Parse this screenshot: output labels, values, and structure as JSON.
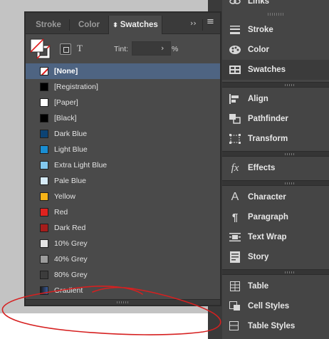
{
  "swatches_panel": {
    "tabs": [
      {
        "label": "Stroke",
        "active": false
      },
      {
        "label": "Color",
        "active": false
      },
      {
        "label": "Swatches",
        "active": true
      }
    ],
    "active_tab_prefix": "⬍",
    "collapse_glyph": "››",
    "menu_glyph": "≡",
    "tint_label": "Tint:",
    "tint_value": "",
    "tint_unit": "%",
    "text_button": "T",
    "swatches": [
      {
        "name": "[None]",
        "color": "none",
        "selected": true
      },
      {
        "name": "[Registration]",
        "color": "#000000",
        "selected": false
      },
      {
        "name": "[Paper]",
        "color": "#ffffff",
        "selected": false
      },
      {
        "name": "[Black]",
        "color": "#000000",
        "selected": false
      },
      {
        "name": "Dark Blue",
        "color": "#0c4374",
        "selected": false
      },
      {
        "name": "Light Blue",
        "color": "#1a8ed3",
        "selected": false
      },
      {
        "name": "Extra Light Blue",
        "color": "#82c8ee",
        "selected": false
      },
      {
        "name": "Pale Blue",
        "color": "#d6ebf8",
        "selected": false
      },
      {
        "name": "Yellow",
        "color": "#f6b418",
        "selected": false
      },
      {
        "name": "Red",
        "color": "#e0231f",
        "selected": false
      },
      {
        "name": "Dark Red",
        "color": "#a51d1b",
        "selected": false
      },
      {
        "name": "10% Grey",
        "color": "#e5e5e5",
        "selected": false
      },
      {
        "name": "40% Grey",
        "color": "#9d9d9d",
        "selected": false
      },
      {
        "name": "80% Grey",
        "color": "#3c3c3c",
        "selected": false
      },
      {
        "name": "Gradient",
        "color": "gradient",
        "selected": false
      }
    ]
  },
  "dock": {
    "top_partial_label": "Links",
    "items": [
      {
        "label": "Stroke",
        "icon": "stroke-lines-icon",
        "active": false
      },
      {
        "label": "Color",
        "icon": "palette-icon",
        "active": false
      },
      {
        "label": "Swatches",
        "icon": "swatches-grid-icon",
        "active": true
      },
      {
        "label": "Align",
        "icon": "align-icon",
        "active": false
      },
      {
        "label": "Pathfinder",
        "icon": "pathfinder-icon",
        "active": false
      },
      {
        "label": "Transform",
        "icon": "transform-icon",
        "active": false
      },
      {
        "label": "Effects",
        "icon": "fx-icon",
        "active": false
      },
      {
        "label": "Character",
        "icon": "character-icon",
        "active": false
      },
      {
        "label": "Paragraph",
        "icon": "paragraph-icon",
        "active": false
      },
      {
        "label": "Text Wrap",
        "icon": "text-wrap-icon",
        "active": false
      },
      {
        "label": "Story",
        "icon": "story-icon",
        "active": false
      },
      {
        "label": "Table",
        "icon": "table-icon",
        "active": false
      },
      {
        "label": "Cell Styles",
        "icon": "cell-styles-icon",
        "active": false
      },
      {
        "label": "Table Styles",
        "icon": "table-styles-icon",
        "active": false
      }
    ],
    "effects_glyph": "fx",
    "character_glyph": "A",
    "paragraph_glyph": "¶"
  },
  "colors": {
    "panel_bg": "#4a4a4a",
    "tab_bg": "#3a3a3a",
    "selection": "#4e6482",
    "annotation": "#e0231f"
  }
}
